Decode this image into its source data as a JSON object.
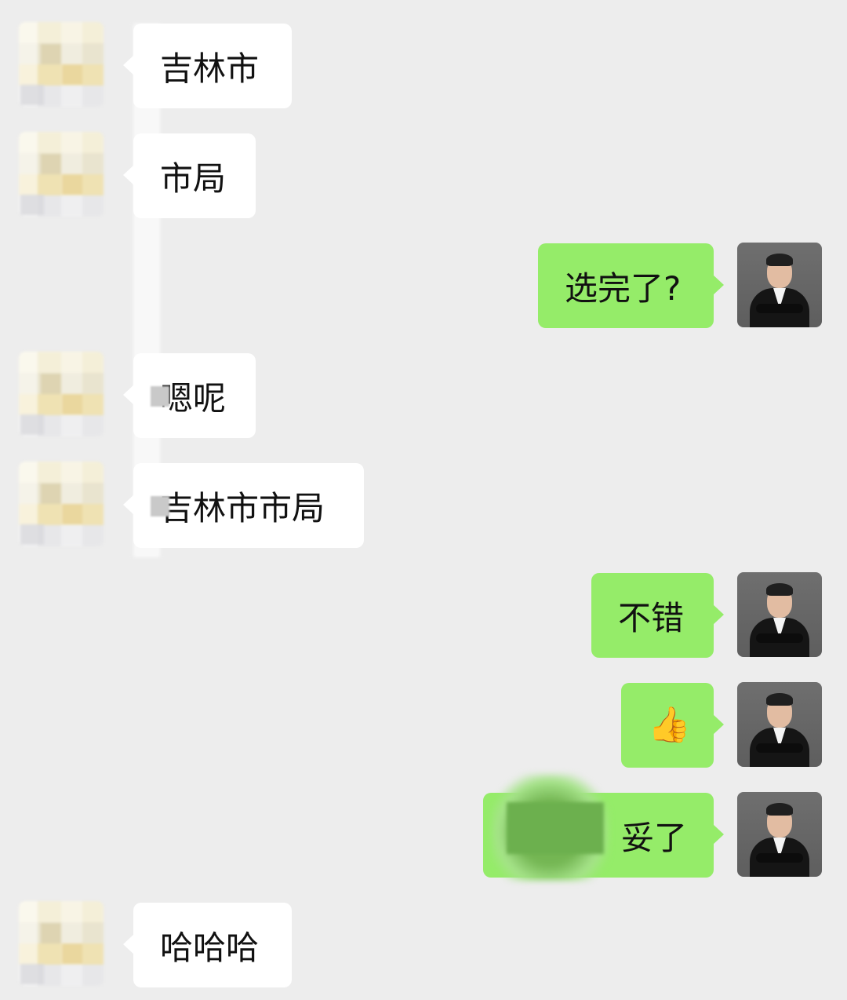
{
  "chat": {
    "messages": [
      {
        "sender": "other",
        "text": "吉林市"
      },
      {
        "sender": "other",
        "text": "市局"
      },
      {
        "sender": "self",
        "text": "选完了?"
      },
      {
        "sender": "other",
        "text": "嗯呢"
      },
      {
        "sender": "other",
        "text": "吉林市市局"
      },
      {
        "sender": "self",
        "text": "不错"
      },
      {
        "sender": "self",
        "text": "👍"
      },
      {
        "sender": "self",
        "text": "妥了"
      },
      {
        "sender": "other",
        "text": "哈哈哈"
      }
    ]
  },
  "colors": {
    "background": "#ededed",
    "self_bubble": "#95ec69",
    "other_bubble": "#ffffff",
    "text": "#111111"
  },
  "icons": {
    "thumbs_up": "thumbs-up-emoji"
  }
}
